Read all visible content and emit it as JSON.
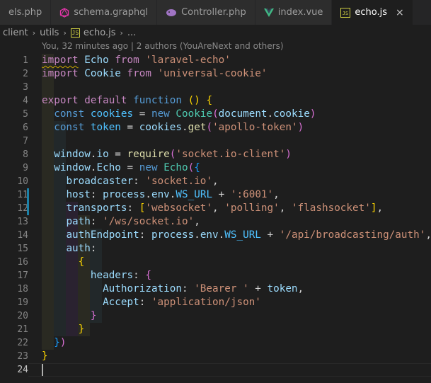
{
  "tabs": [
    {
      "label": "els.php",
      "icon": "php-icon",
      "active": false
    },
    {
      "label": "schema.graphql",
      "icon": "graphql-icon",
      "active": false
    },
    {
      "label": "Controller.php",
      "icon": "php-elephant-icon",
      "active": false
    },
    {
      "label": "index.vue",
      "icon": "vue-icon",
      "active": false
    },
    {
      "label": "echo.js",
      "icon": "js-file-icon",
      "active": true,
      "close": "×"
    }
  ],
  "breadcrumb": {
    "items": [
      "client",
      "utils",
      "echo.js",
      "..."
    ],
    "file_icon_text": "JS",
    "separator": "›"
  },
  "blame": "You, 32 minutes ago | 2 authors (YouAreNext and others)",
  "editor": {
    "line_numbers": [
      "1",
      "2",
      "3",
      "4",
      "5",
      "6",
      "7",
      "8",
      "9",
      "10",
      "11",
      "12",
      "13",
      "14",
      "15",
      "16",
      "17",
      "18",
      "19",
      "20",
      "21",
      "22",
      "23",
      "24"
    ],
    "modified_lines": [
      11,
      12
    ],
    "current_line": 24,
    "colors": {
      "keyword": "#569cd6",
      "control": "#c586c0",
      "string": "#ce9178",
      "function": "#dcdcaa",
      "variable": "#9cdcfe",
      "class": "#4ec9b0"
    }
  }
}
